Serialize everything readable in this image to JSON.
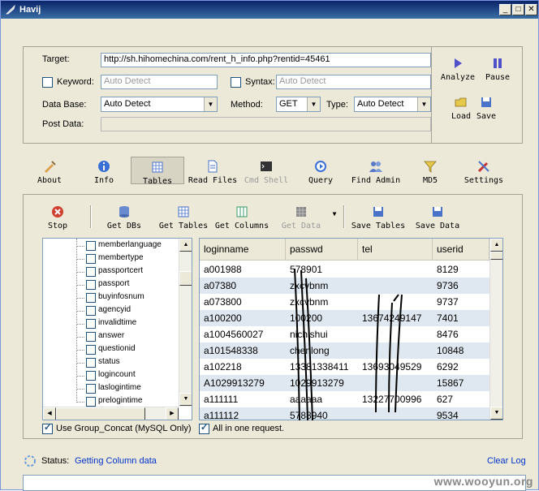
{
  "window": {
    "title": "Havij"
  },
  "form": {
    "target_label": "Target:",
    "target_value": "http://sh.hihomechina.com/rent_h_info.php?rentid=45461",
    "keyword_label": "Keyword:",
    "keyword_placeholder": "Auto Detect",
    "syntax_label": "Syntax:",
    "syntax_placeholder": "Auto Detect",
    "database_label": "Data Base:",
    "database_value": "Auto Detect",
    "method_label": "Method:",
    "method_value": "GET",
    "type_label": "Type:",
    "type_value": "Auto Detect",
    "postdata_label": "Post Data:"
  },
  "actions": {
    "analyze": "Analyze",
    "pause": "Pause",
    "load": "Load",
    "save": "Save"
  },
  "toolbar": {
    "items": [
      {
        "label": "About",
        "icon": "syringe-icon",
        "enabled": true
      },
      {
        "label": "Info",
        "icon": "info-icon",
        "enabled": true
      },
      {
        "label": "Tables",
        "icon": "table-icon",
        "enabled": true,
        "selected": true
      },
      {
        "label": "Read Files",
        "icon": "file-icon",
        "enabled": true
      },
      {
        "label": "Cmd Shell",
        "icon": "terminal-icon",
        "enabled": false
      },
      {
        "label": "Query",
        "icon": "query-icon",
        "enabled": true
      },
      {
        "label": "Find Admin",
        "icon": "users-icon",
        "enabled": true
      },
      {
        "label": "MD5",
        "icon": "funnel-icon",
        "enabled": true
      },
      {
        "label": "Settings",
        "icon": "tools-icon",
        "enabled": true
      }
    ]
  },
  "subtoolbar": {
    "stop": "Stop",
    "get_dbs": "Get DBs",
    "get_tables": "Get Tables",
    "get_columns": "Get Columns",
    "get_data": "Get Data",
    "save_tables": "Save Tables",
    "save_data": "Save Data"
  },
  "tree": {
    "items": [
      "memberlanguage",
      "membertype",
      "passportcert",
      "passport",
      "buyinfosnum",
      "agencyid",
      "invalidtime",
      "answer",
      "questionid",
      "status",
      "logincount",
      "laslogintime",
      "prelogintime"
    ]
  },
  "grid": {
    "columns": [
      "loginname",
      "passwd",
      "tel",
      "userid"
    ],
    "rows": [
      [
        "a001988",
        "578901",
        "",
        "8129"
      ],
      [
        "a07380",
        "zxcvbnm",
        "",
        "9736"
      ],
      [
        "a073800",
        "zxcvbnm",
        "",
        "9737"
      ],
      [
        "a100200",
        "100200",
        "13674249147",
        "7401"
      ],
      [
        "a1004560027",
        "nichishui",
        "",
        "8476"
      ],
      [
        "a101548338",
        "chenlong",
        "",
        "10848"
      ],
      [
        "a102218",
        "13381338411",
        "13693049529",
        "6292"
      ],
      [
        "A1029913279",
        "1029913279",
        "",
        "15867"
      ],
      [
        "a111111",
        "aaaaaa",
        "13227700996",
        "627"
      ],
      [
        "a111112",
        "5788940",
        "",
        "9534"
      ]
    ]
  },
  "options": {
    "group_concat": "Use Group_Concat (MySQL Only)",
    "all_in_one": "All in one request."
  },
  "status": {
    "label": "Status:",
    "value": "Getting Column data",
    "clear_log": "Clear Log"
  },
  "watermark": "www.wooyun.org",
  "colors": {
    "title_start": "#0a246a",
    "title_end": "#3a6ea5",
    "link": "#0033cc",
    "row_alt": "#dfe8f0"
  }
}
